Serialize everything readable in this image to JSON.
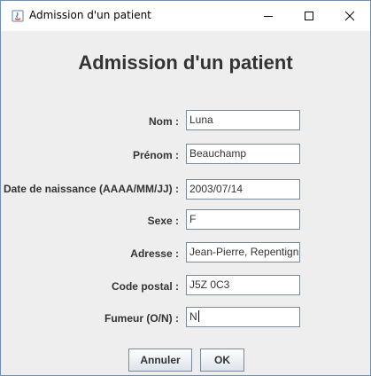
{
  "window": {
    "title": "Admission d'un patient"
  },
  "form": {
    "heading": "Admission d'un patient",
    "fields": [
      {
        "label": "Nom :",
        "value": "Luna"
      },
      {
        "label": "Prénom :",
        "value": "Beauchamp"
      },
      {
        "label": "Date de naissance (AAAA/MM/JJ) :",
        "value": "2003/07/14"
      },
      {
        "label": "Sexe :",
        "value": "F"
      },
      {
        "label": "Adresse :",
        "value": "Jean-Pierre, Repentign"
      },
      {
        "label": "Code postal :",
        "value": "J5Z 0C3"
      },
      {
        "label": "Fumeur (O/N) :",
        "value": "N"
      }
    ]
  },
  "buttons": {
    "cancel": "Annuler",
    "ok": "OK"
  },
  "icons": {
    "app": "java-app-icon",
    "minimize": "minimize-icon",
    "maximize": "maximize-icon",
    "close": "close-icon"
  },
  "colors": {
    "window_border": "#6f8fb3",
    "background": "#eeeeee",
    "text": "#333333"
  }
}
